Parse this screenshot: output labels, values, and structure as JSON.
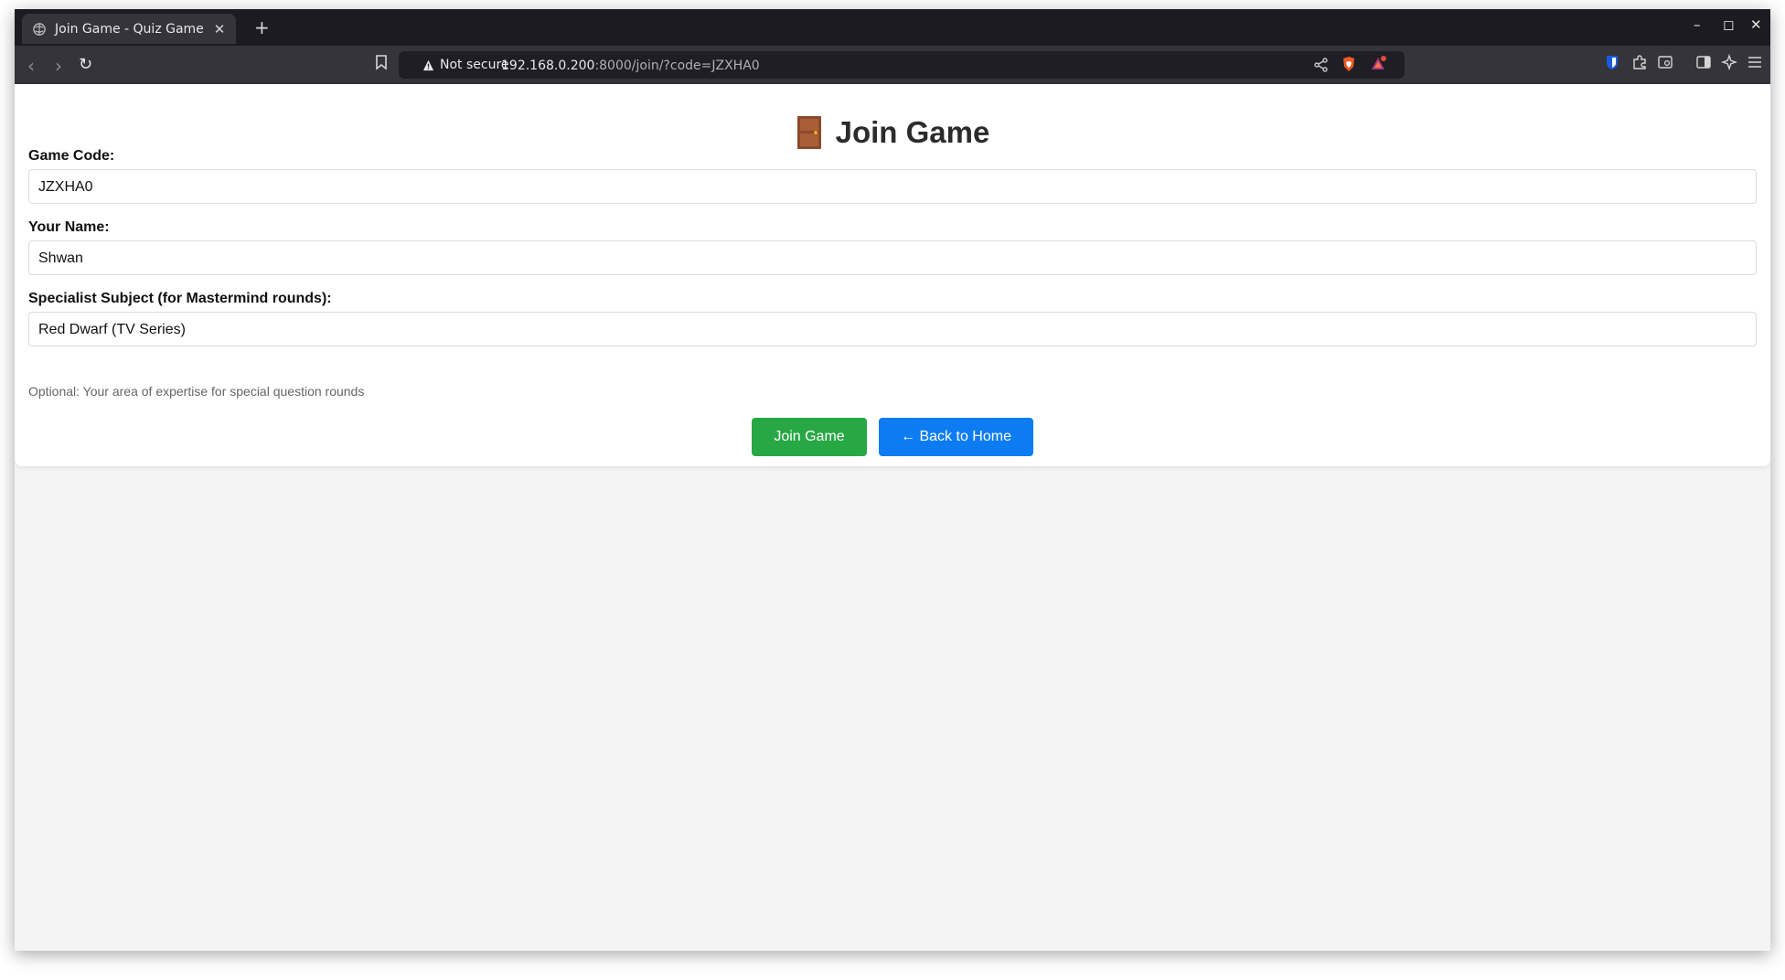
{
  "browser": {
    "tab_title": "Join Game - Quiz Game",
    "tab_close": "✕",
    "new_tab": "+",
    "security_label": "Not secure",
    "url_host": "192.168.0.200",
    "url_path": ":8000/join/?code=JZXHA0",
    "window_controls": {
      "minimize": "–",
      "maximize": "◻",
      "close": "✕"
    }
  },
  "page": {
    "title": "Join Game",
    "title_icon": "door-icon",
    "fields": [
      {
        "label": "Game Code:",
        "value": "JZXHA0"
      },
      {
        "label": "Your Name:",
        "value": "Shwan"
      },
      {
        "label": "Specialist Subject (for Mastermind rounds):",
        "value": "Red Dwarf (TV Series)"
      }
    ],
    "hint": "Optional: Your area of expertise for special question rounds",
    "buttons": {
      "join": "Join Game",
      "home": "← Back to Home"
    }
  },
  "colors": {
    "join_button": "#28a745",
    "home_button": "#0d7cf2",
    "browser_chrome": "#35343a"
  }
}
